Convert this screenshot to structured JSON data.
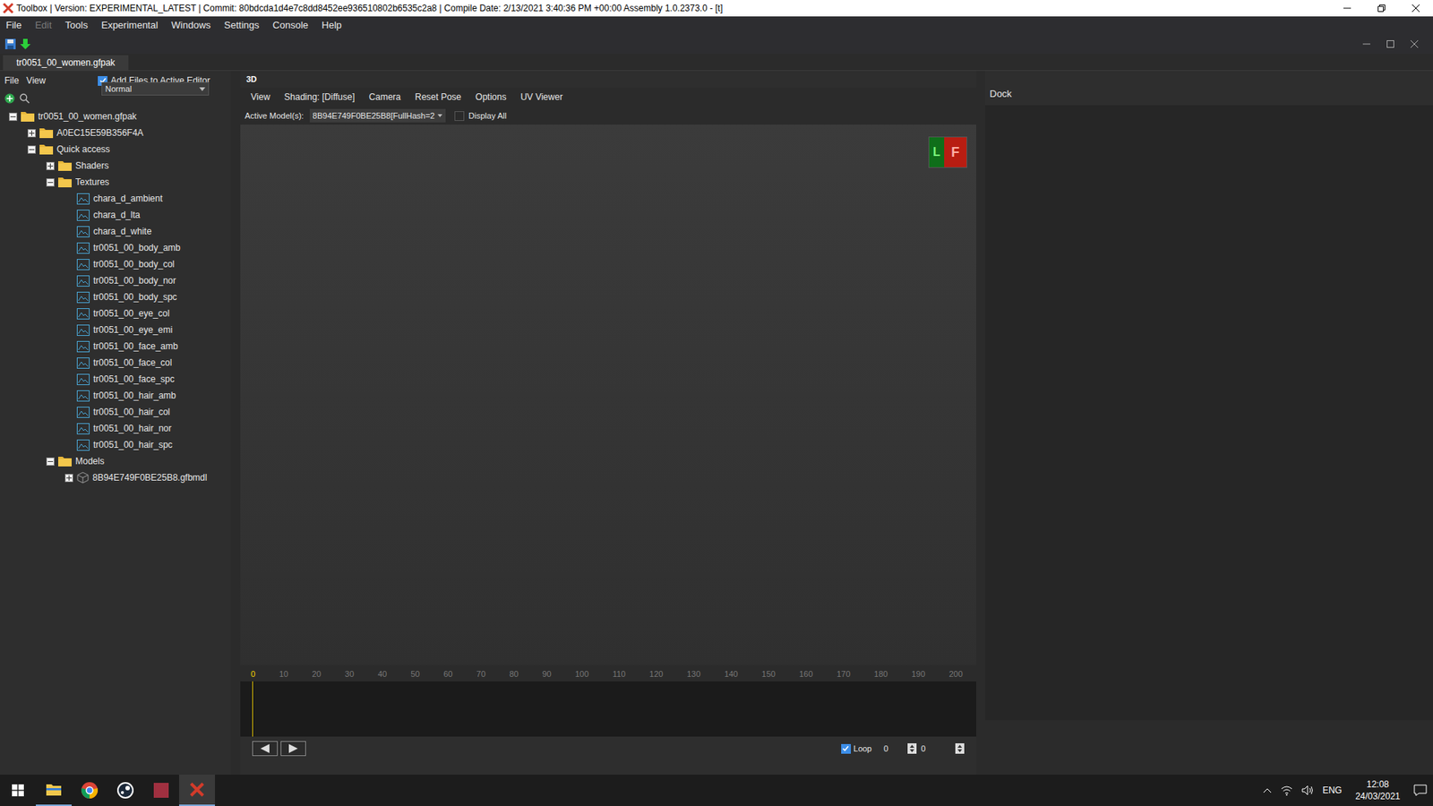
{
  "window": {
    "title": "Toolbox | Version: EXPERIMENTAL_LATEST | Commit: 80bdcda1d4e7c8dd8452ee936510802b6535c2a8 | Compile Date: 2/13/2021 3:40:36 PM +00:00 Assembly 1.0.2373.0 - [t]"
  },
  "menu": [
    {
      "label": "File",
      "disabled": false
    },
    {
      "label": "Edit",
      "disabled": true
    },
    {
      "label": "Tools",
      "disabled": false
    },
    {
      "label": "Experimental",
      "disabled": false
    },
    {
      "label": "Windows",
      "disabled": false
    },
    {
      "label": "Settings",
      "disabled": false
    },
    {
      "label": "Console",
      "disabled": false
    },
    {
      "label": "Help",
      "disabled": false
    }
  ],
  "document_tabs": [
    {
      "label": "tr0051_00_women.gfpak",
      "selected": true
    }
  ],
  "explorer": {
    "menu": [
      "File",
      "View"
    ],
    "add_files_checkbox": {
      "label": "Add Files to Active Editor",
      "checked": true
    },
    "mode_dropdown": {
      "value": "Normal"
    },
    "tree": [
      {
        "label": "tr0051_00_women.gfpak",
        "depth": 0,
        "kind": "folder",
        "expanded": true
      },
      {
        "label": "A0EC15E59B356F4A",
        "depth": 1,
        "kind": "folder",
        "expanded": false
      },
      {
        "label": "Quick access",
        "depth": 1,
        "kind": "folder",
        "expanded": true
      },
      {
        "label": "Shaders",
        "depth": 2,
        "kind": "folder",
        "expanded": false
      },
      {
        "label": "Textures",
        "depth": 2,
        "kind": "folder",
        "expanded": true
      },
      {
        "label": "chara_d_ambient",
        "depth": 3,
        "kind": "texture",
        "expanded": false
      },
      {
        "label": "chara_d_lta",
        "depth": 3,
        "kind": "texture",
        "expanded": false
      },
      {
        "label": "chara_d_white",
        "depth": 3,
        "kind": "texture",
        "expanded": false
      },
      {
        "label": "tr0051_00_body_amb",
        "depth": 3,
        "kind": "texture",
        "expanded": false
      },
      {
        "label": "tr0051_00_body_col",
        "depth": 3,
        "kind": "texture",
        "expanded": false
      },
      {
        "label": "tr0051_00_body_nor",
        "depth": 3,
        "kind": "texture",
        "expanded": false
      },
      {
        "label": "tr0051_00_body_spc",
        "depth": 3,
        "kind": "texture",
        "expanded": false
      },
      {
        "label": "tr0051_00_eye_col",
        "depth": 3,
        "kind": "texture",
        "expanded": false
      },
      {
        "label": "tr0051_00_eye_emi",
        "depth": 3,
        "kind": "texture",
        "expanded": false
      },
      {
        "label": "tr0051_00_face_amb",
        "depth": 3,
        "kind": "texture",
        "expanded": false
      },
      {
        "label": "tr0051_00_face_col",
        "depth": 3,
        "kind": "texture",
        "expanded": false
      },
      {
        "label": "tr0051_00_face_spc",
        "depth": 3,
        "kind": "texture",
        "expanded": false
      },
      {
        "label": "tr0051_00_hair_amb",
        "depth": 3,
        "kind": "texture",
        "expanded": false
      },
      {
        "label": "tr0051_00_hair_col",
        "depth": 3,
        "kind": "texture",
        "expanded": false
      },
      {
        "label": "tr0051_00_hair_nor",
        "depth": 3,
        "kind": "texture",
        "expanded": false
      },
      {
        "label": "tr0051_00_hair_spc",
        "depth": 3,
        "kind": "texture",
        "expanded": false
      },
      {
        "label": "Models",
        "depth": 2,
        "kind": "folder",
        "expanded": true
      },
      {
        "label": "8B94E749F0BE25B8.gfbmdl",
        "depth": 3,
        "kind": "model",
        "expanded": false
      }
    ]
  },
  "viewer": {
    "tab": "3D",
    "toolbar": [
      "View",
      "Shading: [Diffuse]",
      "Camera",
      "Reset Pose",
      "Options",
      "UV Viewer"
    ],
    "active_model_label": "Active Model(s):",
    "active_model_value": "8B94E749F0BE25B8[FullHash=2",
    "display_all": {
      "label": "Display All",
      "checked": false
    },
    "gizmo": [
      "L",
      "F"
    ]
  },
  "timeline": {
    "ticks": [
      "0",
      "10",
      "20",
      "30",
      "40",
      "50",
      "60",
      "70",
      "80",
      "90",
      "100",
      "110",
      "120",
      "130",
      "140",
      "150",
      "160",
      "170",
      "180",
      "190",
      "200"
    ],
    "playhead_level": 0,
    "loop": {
      "label": "Loop",
      "checked": true
    },
    "frame": "0",
    "spinner_value": "0"
  },
  "dock": {
    "title": "Dock"
  },
  "taskbar": {
    "language": "ENG",
    "time": "12:08",
    "date": "24/03/2021"
  }
}
